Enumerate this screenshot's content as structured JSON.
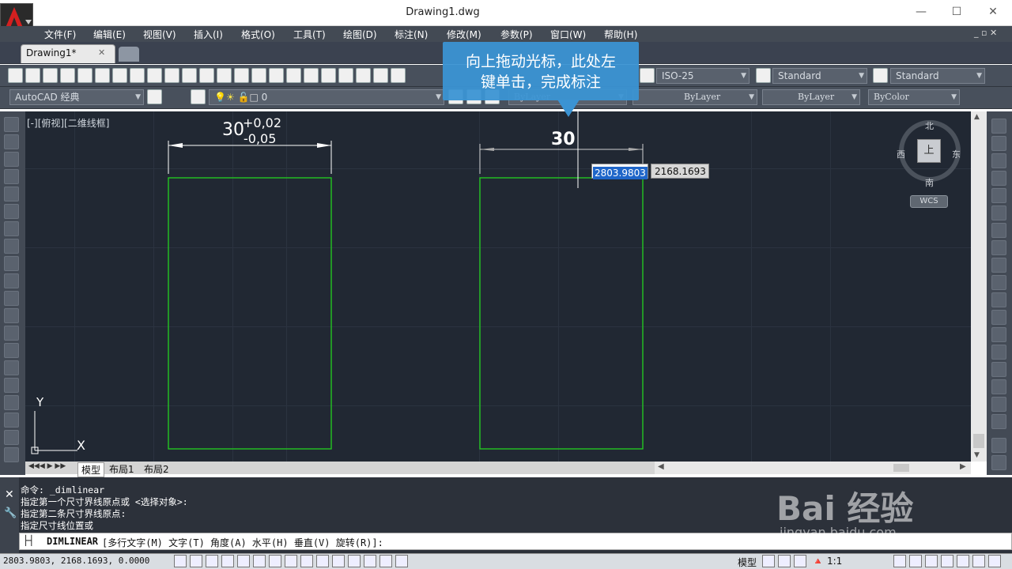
{
  "window": {
    "title": "Drawing1.dwg",
    "minimize": "—",
    "maximize": "☐",
    "close": "✕"
  },
  "menu": [
    "文件(F)",
    "编辑(E)",
    "视图(V)",
    "插入(I)",
    "格式(O)",
    "工具(T)",
    "绘图(D)",
    "标注(N)",
    "修改(M)",
    "参数(P)",
    "窗口(W)",
    "帮助(H)"
  ],
  "tab": {
    "label": "Drawing1*",
    "close": "✕"
  },
  "toolbar": {
    "text_style": "ISO-25",
    "dim_style": "Standard",
    "table_style": "Standard",
    "workspace": "AutoCAD 经典",
    "layer": "0",
    "color": "ByLayer",
    "linetype": "ByLayer",
    "lineweight": "ByLayer",
    "plotstyle": "ByColor"
  },
  "viewport": {
    "label": "[-][俯视][二维线框]"
  },
  "drawing": {
    "left_dim_value": "30",
    "left_dim_upper_tol": "+0,02",
    "left_dim_lower_tol": "-0,05",
    "right_dim_value": "30"
  },
  "callout": {
    "line1": "向上拖动光标，此处左",
    "line2": "键单击，完成标注"
  },
  "dynamic_input": {
    "x": "2803.9803",
    "y": "2168.1693"
  },
  "viewcube": {
    "north": "北",
    "south": "南",
    "east": "东",
    "west": "西",
    "top": "上",
    "wcs": "WCS"
  },
  "ucs": {
    "x": "X",
    "y": "Y"
  },
  "layout_tabs": [
    "模型",
    "布局1",
    "布局2"
  ],
  "command": {
    "history": [
      "命令: _dimlinear",
      "指定第一个尺寸界线原点或 <选择对象>:",
      "指定第二条尺寸界线原点:",
      "指定尺寸线位置或"
    ],
    "prompt_cmd": "DIMLINEAR",
    "prompt_opts": "[多行文字(M) 文字(T) 角度(A) 水平(H) 垂直(V) 旋转(R)]:"
  },
  "status": {
    "coords": "2803.9803, 2168.1693, 0.0000",
    "model": "模型",
    "scale": "1:1"
  },
  "watermark": {
    "brand": "Bai 经验",
    "url": "jingyan.baidu.com"
  },
  "colors": {
    "canvas": "#212833",
    "shape": "#22d11f",
    "callout": "#3b93d3",
    "menubar": "#434a54"
  }
}
